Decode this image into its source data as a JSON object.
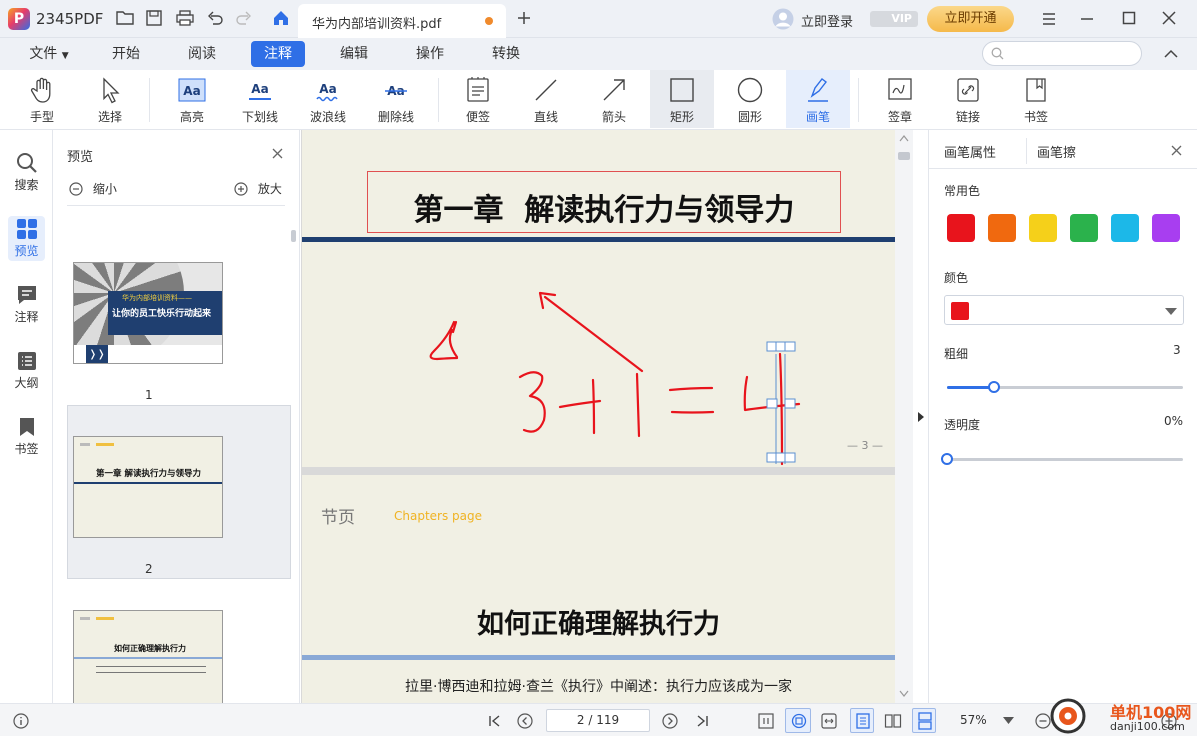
{
  "app": {
    "name": "2345PDF"
  },
  "tab": {
    "title": "华为内部培训资料.pdf"
  },
  "account": {
    "login_label": "立即登录",
    "vip_badge": "VIP",
    "open_vip_label": "立即开通"
  },
  "menu": {
    "file": "文件",
    "start": "开始",
    "read": "阅读",
    "annotate": "注释",
    "edit": "编辑",
    "operate": "操作",
    "convert": "转换"
  },
  "search": {
    "placeholder": ""
  },
  "tools": {
    "hand": "手型",
    "select": "选择",
    "highlight": "高亮",
    "underline": "下划线",
    "wavy": "波浪线",
    "strike": "删除线",
    "note": "便签",
    "line": "直线",
    "arrow": "箭头",
    "rect": "矩形",
    "ellipse": "圆形",
    "pen": "画笔",
    "stamp": "签章",
    "link": "链接",
    "bookmark": "书签"
  },
  "rail": {
    "search": "搜索",
    "preview": "预览",
    "annotations": "注释",
    "outline": "大纲",
    "bookmarks": "书签"
  },
  "thumbs": {
    "title": "预览",
    "zoom_out": "缩小",
    "zoom_in": "放大",
    "p1_num": "1",
    "p1_line1": "华为内部培训资料——",
    "p1_line2": "让你的员工快乐行动起来",
    "p2_num": "2",
    "p2_head": "第一章  解读执行力与领导力",
    "p3_head": "如何正确理解执行力"
  },
  "page2": {
    "heading": "第一章  解读执行力与领导力",
    "page_num": "— 3 —"
  },
  "page3": {
    "section": "节页",
    "chapters": "Chapters page",
    "heading": "如何正确理解执行力",
    "body": "拉里·博西迪和拉姆·查兰《执行》中阐述：执行力应该成为一家"
  },
  "props": {
    "tab_pen": "画笔属性",
    "tab_eraser": "画笔擦",
    "common_colors": "常用色",
    "color_label": "颜色",
    "thickness_label": "粗细",
    "thickness_value": "3",
    "opacity_label": "透明度",
    "opacity_value": "0%",
    "thickness_level": 0.2,
    "opacity_level": 0.0,
    "swatches": [
      "#e8141c",
      "#f0690f",
      "#f5d01a",
      "#2bb24c",
      "#1cb8e8",
      "#a83ef0"
    ],
    "selected_color": "#e8141c"
  },
  "status": {
    "page_input": "2 / 119",
    "zoom": "57%"
  },
  "watermark": {
    "site": "单机100网",
    "url": "danji100.com"
  }
}
